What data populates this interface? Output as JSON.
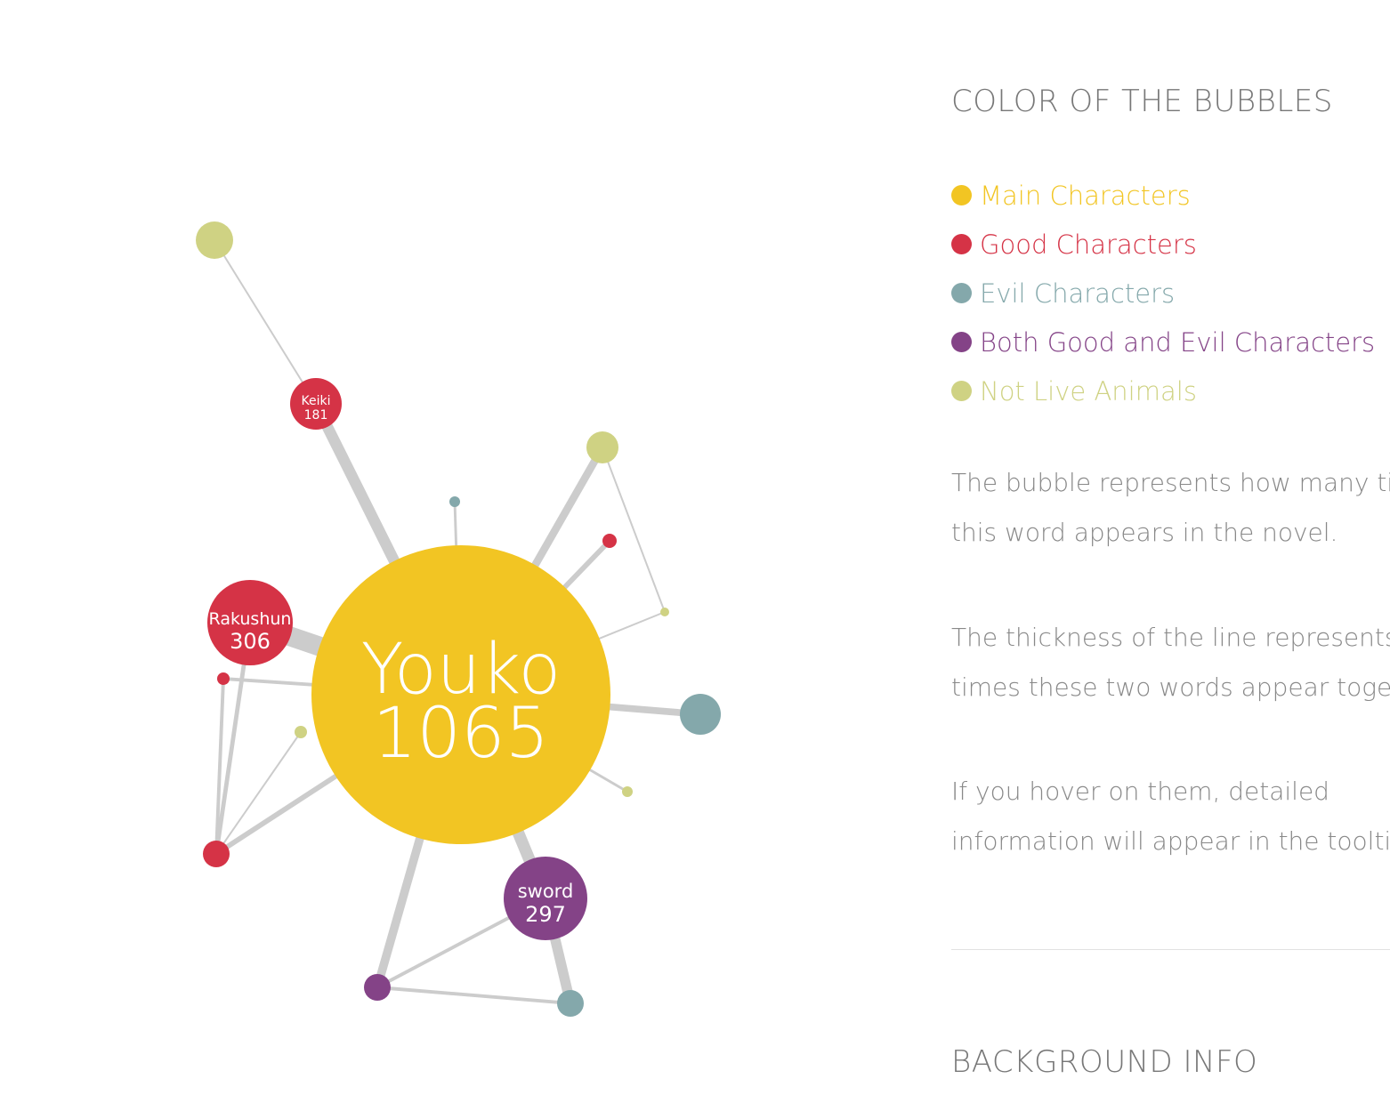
{
  "graph": {
    "nodes": [
      {
        "id": "youko",
        "label": "Youko",
        "count": "1065",
        "category": "main"
      },
      {
        "id": "rakushun",
        "label": "Rakushun",
        "count": "306",
        "category": "good"
      },
      {
        "id": "sword",
        "label": "sword",
        "count": "297",
        "category": "both"
      },
      {
        "id": "keiki",
        "label": "Keiki",
        "count": "181",
        "category": "good"
      },
      {
        "id": "n-animal-top",
        "label": "",
        "count": "",
        "category": "animal"
      },
      {
        "id": "n-animal-upper-right",
        "label": "",
        "count": "",
        "category": "animal"
      },
      {
        "id": "n-evil-top-small",
        "label": "",
        "count": "",
        "category": "evil"
      },
      {
        "id": "n-good-upper-right-small",
        "label": "",
        "count": "",
        "category": "good"
      },
      {
        "id": "n-animal-right-small",
        "label": "",
        "count": "",
        "category": "animal"
      },
      {
        "id": "n-evil-right",
        "label": "",
        "count": "",
        "category": "evil"
      },
      {
        "id": "n-animal-lower-right-small",
        "label": "",
        "count": "",
        "category": "animal"
      },
      {
        "id": "n-good-left-small",
        "label": "",
        "count": "",
        "category": "good"
      },
      {
        "id": "n-animal-left-small",
        "label": "",
        "count": "",
        "category": "animal"
      },
      {
        "id": "n-good-lower-left",
        "label": "",
        "count": "",
        "category": "good"
      },
      {
        "id": "n-both-bottom",
        "label": "",
        "count": "",
        "category": "both"
      },
      {
        "id": "n-evil-bottom",
        "label": "",
        "count": "",
        "category": "evil"
      }
    ],
    "links": [
      {
        "source": "youko",
        "target": "keiki",
        "weight": 12
      },
      {
        "source": "keiki",
        "target": "n-animal-top",
        "weight": 1
      },
      {
        "source": "youko",
        "target": "rakushun",
        "weight": 22
      },
      {
        "source": "youko",
        "target": "n-evil-top-small",
        "weight": 2
      },
      {
        "source": "youko",
        "target": "n-animal-upper-right",
        "weight": 8
      },
      {
        "source": "youko",
        "target": "n-good-upper-right-small",
        "weight": 5
      },
      {
        "source": "n-animal-upper-right",
        "target": "n-animal-right-small",
        "weight": 1
      },
      {
        "source": "youko",
        "target": "n-animal-right-small",
        "weight": 1
      },
      {
        "source": "youko",
        "target": "n-evil-right",
        "weight": 7
      },
      {
        "source": "youko",
        "target": "n-animal-lower-right-small",
        "weight": 2
      },
      {
        "source": "youko",
        "target": "sword",
        "weight": 13
      },
      {
        "source": "sword",
        "target": "n-evil-bottom",
        "weight": 11
      },
      {
        "source": "youko",
        "target": "n-both-bottom",
        "weight": 9
      },
      {
        "source": "sword",
        "target": "n-both-bottom",
        "weight": 3
      },
      {
        "source": "n-both-bottom",
        "target": "n-evil-bottom",
        "weight": 3
      },
      {
        "source": "youko",
        "target": "n-good-left-small",
        "weight": 3
      },
      {
        "source": "n-good-left-small",
        "target": "n-good-lower-left",
        "weight": 3
      },
      {
        "source": "rakushun",
        "target": "n-good-lower-left",
        "weight": 4
      },
      {
        "source": "youko",
        "target": "n-good-lower-left",
        "weight": 5
      },
      {
        "source": "n-animal-left-small",
        "target": "n-good-lower-left",
        "weight": 1
      }
    ]
  },
  "legend": {
    "title": "COLOR OF THE BUBBLES",
    "items": [
      {
        "category": "main",
        "label": "Main Characters",
        "color": "#f2c523"
      },
      {
        "category": "good",
        "label": "Good Characters",
        "color": "#d53346"
      },
      {
        "category": "evil",
        "label": "Evil Characters",
        "color": "#84a8ab"
      },
      {
        "category": "both",
        "label": "Both Good and Evil Characters",
        "color": "#844387"
      },
      {
        "category": "animal",
        "label": "Not Live Animals",
        "color": "#cfd283"
      }
    ]
  },
  "notes": {
    "bubble_size": [
      "The bubble represents how many times",
      "this word appears in the novel."
    ],
    "line_thickness": [
      "The thickness of the line represents how many",
      "times these two words appear together."
    ],
    "hover": [
      "If you hover on them, detailed",
      "information will appear in the tooltip."
    ]
  },
  "background": {
    "title": "BACKGROUND INFO"
  },
  "colors": {
    "link": "#cccccc",
    "text_muted": "#888888"
  }
}
